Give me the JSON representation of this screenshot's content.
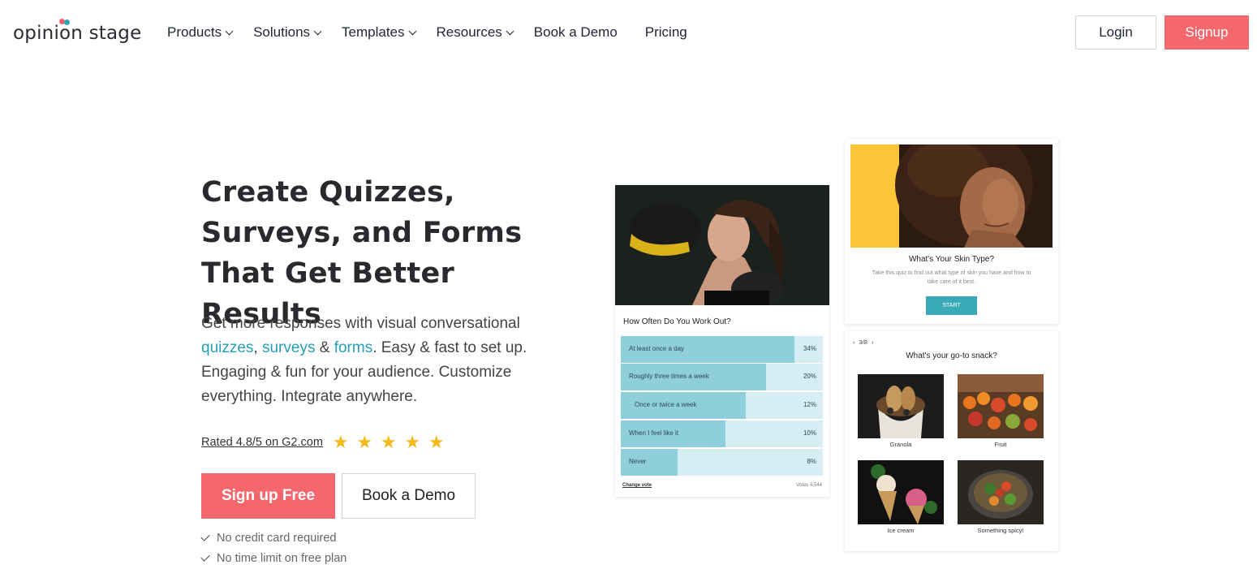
{
  "header": {
    "logo_text": "opinion stage",
    "nav": [
      {
        "label": "Products",
        "dropdown": true
      },
      {
        "label": "Solutions",
        "dropdown": true
      },
      {
        "label": "Templates",
        "dropdown": true
      },
      {
        "label": "Resources",
        "dropdown": true
      },
      {
        "label": "Book a Demo",
        "dropdown": false
      },
      {
        "label": "Pricing",
        "dropdown": false
      }
    ],
    "login_label": "Login",
    "signup_label": "Signup"
  },
  "hero": {
    "title": "Create Quizzes, Surveys, and Forms That Get Better Results",
    "desc_prefix": "Get more responses with visual conversational",
    "link_quizzes": "quizzes",
    "sep1": ", ",
    "link_surveys": "surveys",
    "sep2": " & ",
    "link_forms": "forms",
    "desc_suffix": ". Easy & fast to set up. Engaging & fun for your audience. Customize everything. Integrate anywhere.",
    "rating_text": "Rated 4.8/5 on G2.com",
    "rating_value": 4.8,
    "rating_max": 5,
    "signup_free_label": "Sign up Free",
    "book_demo_label": "Book a Demo",
    "checks": [
      "No credit card required",
      "No time limit on free plan"
    ]
  },
  "poll": {
    "question": "How Often Do You Work Out?",
    "options": [
      {
        "label": "At least once a day",
        "pct_text": "34%",
        "fill": 0.86
      },
      {
        "label": "Roughly three times a week",
        "pct_text": "20%",
        "fill": 0.72
      },
      {
        "label": "Once or twice a week",
        "pct_text": "12%",
        "fill": 0.62
      },
      {
        "label": "When I feel like it",
        "pct_text": "10%",
        "fill": 0.52
      },
      {
        "label": "Never",
        "pct_text": "8%",
        "fill": 0.28
      }
    ],
    "change_vote": "Change vote",
    "votes": "Votes 4,544"
  },
  "skin_quiz": {
    "title": "What's Your Skin Type?",
    "subtitle": "Take this quiz to find out what type of skin you have and how to take care of it best.",
    "start_label": "START"
  },
  "snack": {
    "counter": "3/8",
    "title": "What's your go-to snack?",
    "items": [
      "Granola",
      "Fruit",
      "Ice cream",
      "Something spicy!"
    ]
  },
  "colors": {
    "brand_red": "#f4676c",
    "link_teal": "#26a0b4",
    "star_yellow": "#f5bb1c",
    "poll_fill": "#8ecfdb",
    "poll_track": "#d6eef3"
  }
}
